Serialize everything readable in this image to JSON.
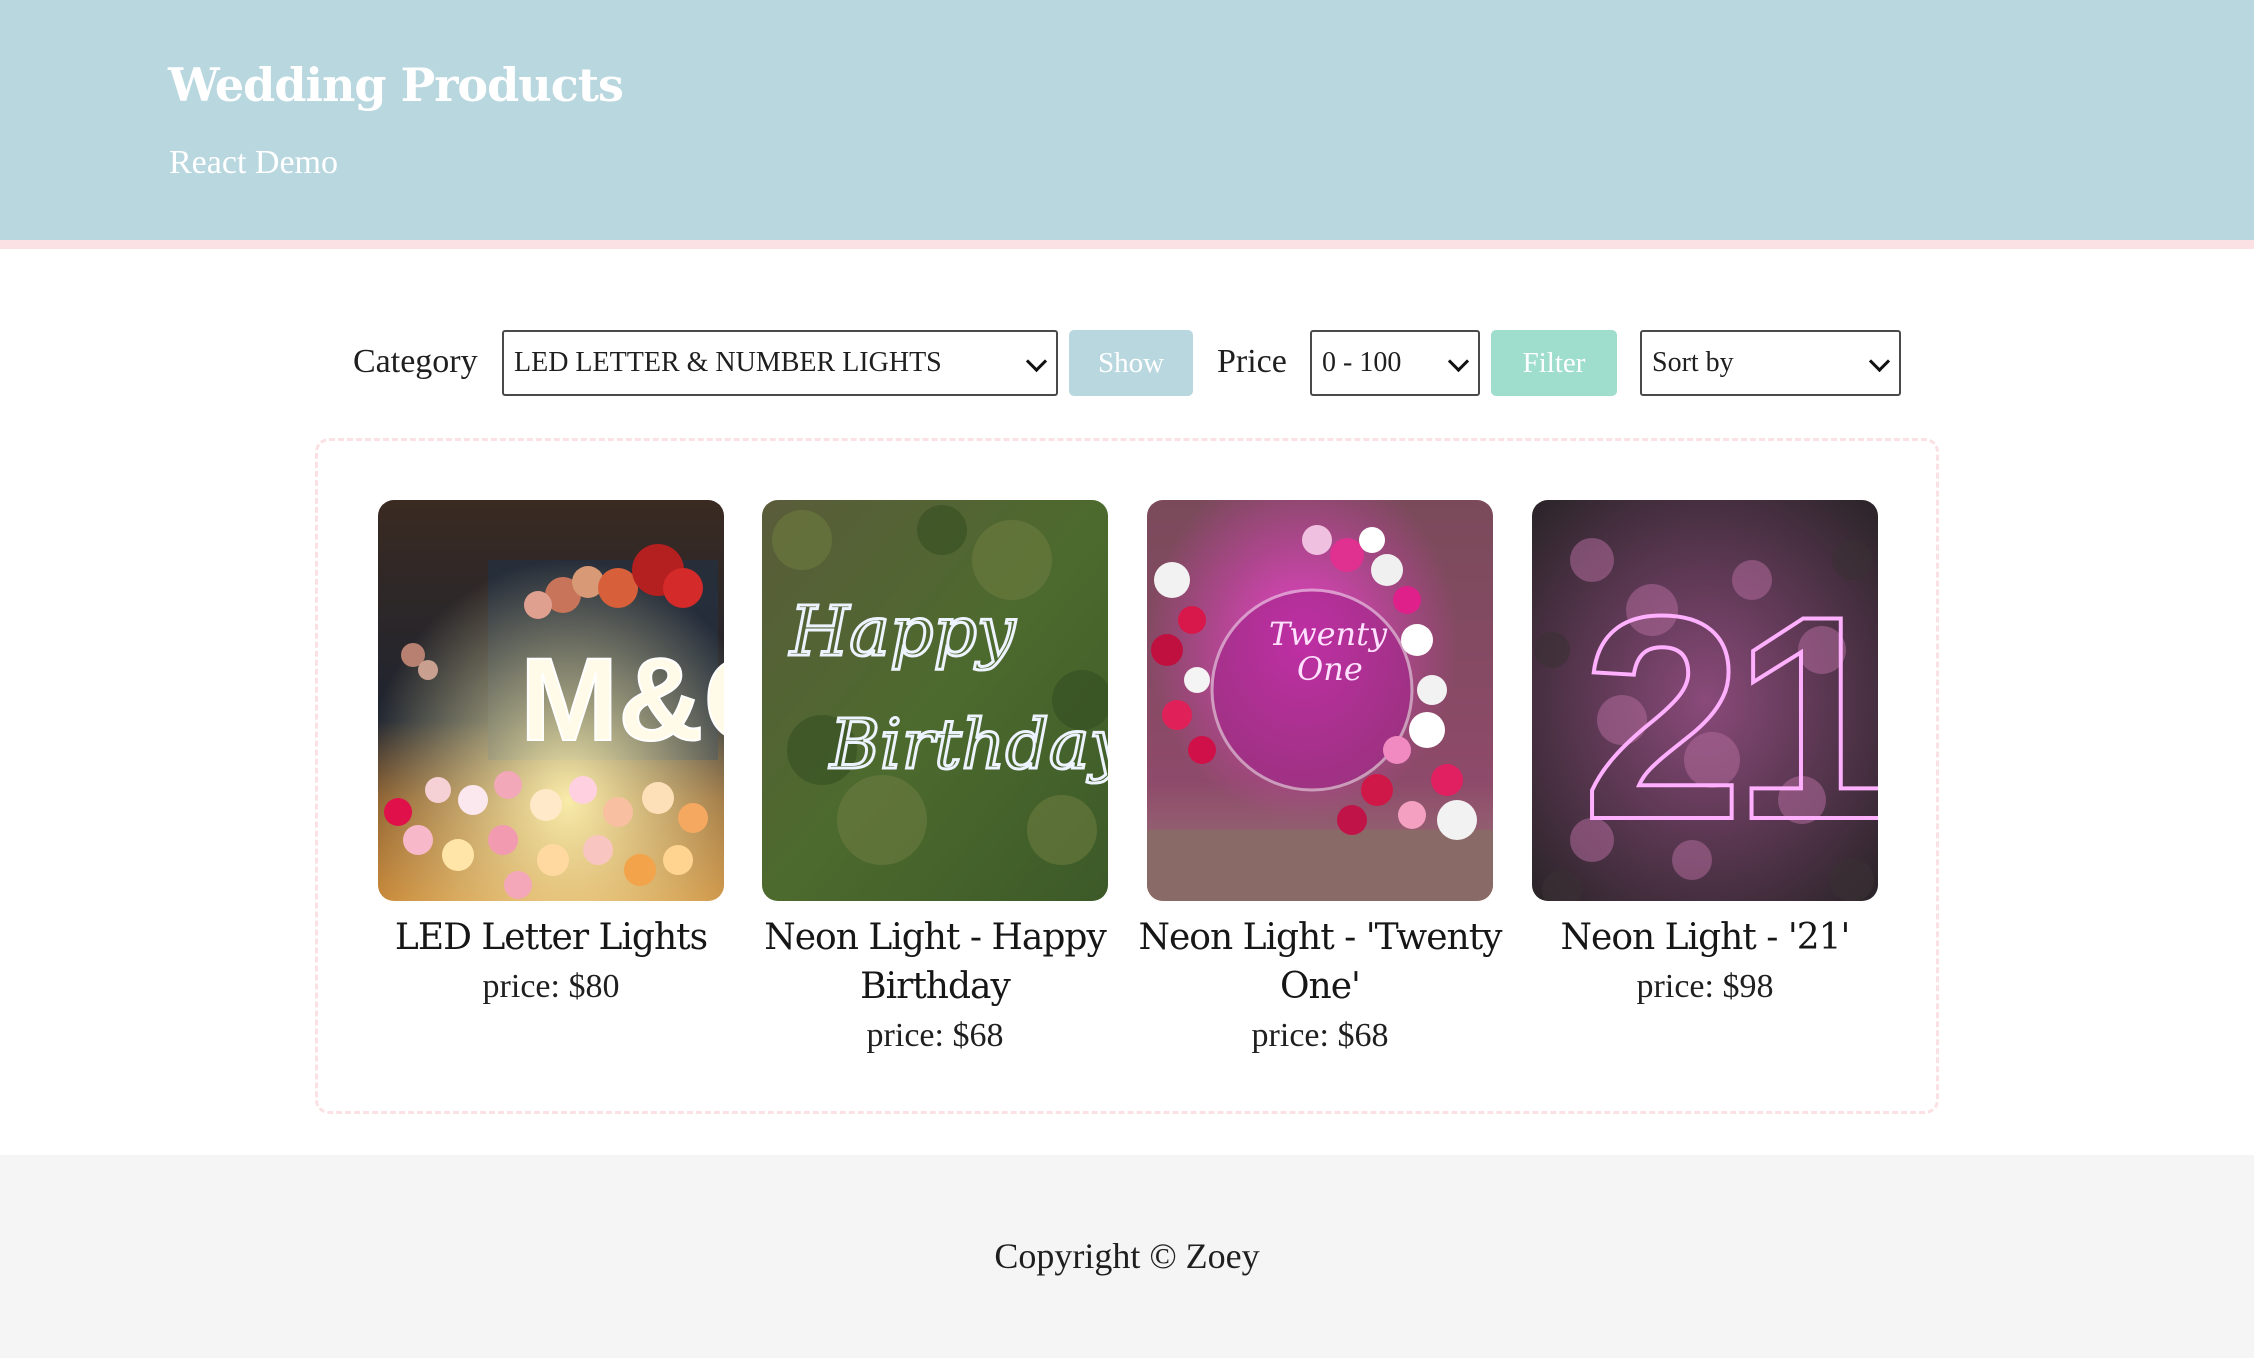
{
  "header": {
    "title": "Wedding Products",
    "subtitle": "React Demo",
    "background_color": "#b9d7df",
    "stripe_color": "#fbe1e3"
  },
  "filters": {
    "category_label": "Category",
    "category_selected": "LED LETTER & NUMBER LIGHTS",
    "show_button": "Show",
    "price_label": "Price",
    "price_selected": "0 - 100",
    "filter_button": "Filter",
    "sort_selected": "Sort by",
    "show_button_color": "#b9d7df",
    "filter_button_color": "#9fddcc"
  },
  "products": [
    {
      "name": "LED Letter Lights",
      "price": "price: $80",
      "image_icon": "led-letter-lights-photo"
    },
    {
      "name": "Neon Light - Happy Birthday",
      "price": "price: $68",
      "image_icon": "neon-happy-birthday-photo"
    },
    {
      "name": "Neon Light - 'Twenty One'",
      "price": "price: $68",
      "image_icon": "neon-twenty-one-photo"
    },
    {
      "name": "Neon Light - '21'",
      "price": "price: $98",
      "image_icon": "neon-21-photo"
    }
  ],
  "footer": {
    "copyright": "Copyright © Zoey"
  }
}
